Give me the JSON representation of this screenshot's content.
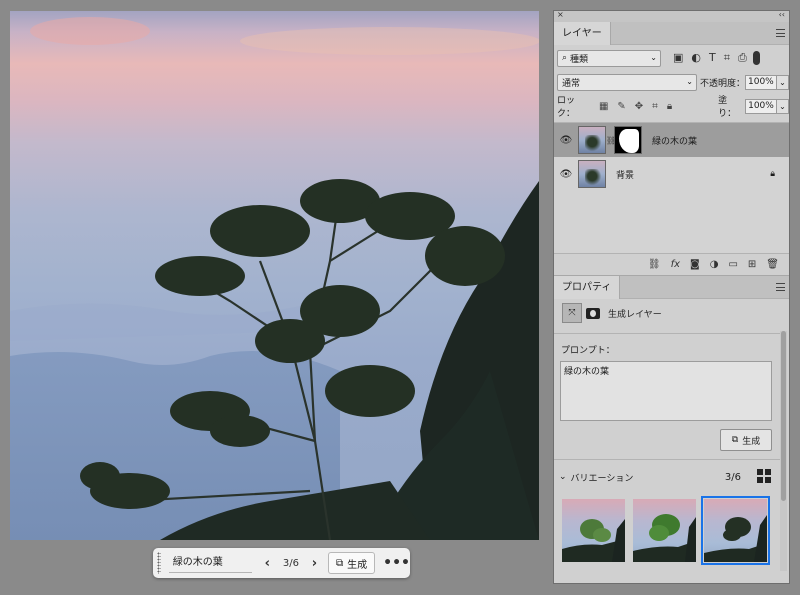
{
  "taskbar": {
    "prompt_value": "緑の木の葉",
    "prev_label": "‹",
    "next_label": "›",
    "count": "3/6",
    "generate_label": "生成",
    "more_label": "•••"
  },
  "layers_panel": {
    "close": "×",
    "collapse": "‹‹",
    "tab": "レイヤー",
    "filter_kind": "種類",
    "blend_mode": "通常",
    "opacity_label": "不透明度：",
    "opacity_value": "100%",
    "lock_label": "ロック：",
    "fill_label": "塗り：",
    "fill_value": "100%",
    "layers": [
      {
        "name": "緑の木の葉",
        "selected": true
      },
      {
        "name": "背景",
        "locked": true
      }
    ],
    "bottom_icons": [
      "link-icon",
      "fx-icon",
      "mask-icon",
      "adjustment-icon",
      "folder-icon",
      "new-layer-icon",
      "trash-icon"
    ]
  },
  "properties_panel": {
    "tab": "プロパティ",
    "layer_type": "生成レイヤー",
    "prompt_label": "プロンプト：",
    "prompt_text": "緑の木の葉",
    "generate_label": "生成",
    "variations_label": "バリエーション",
    "variations_count": "3/6",
    "selected_variation": 3
  },
  "colors": {
    "selection": "#1a73e8",
    "selected_layer": "#9d9d9d",
    "panel_bg": "#d0d0d0"
  }
}
